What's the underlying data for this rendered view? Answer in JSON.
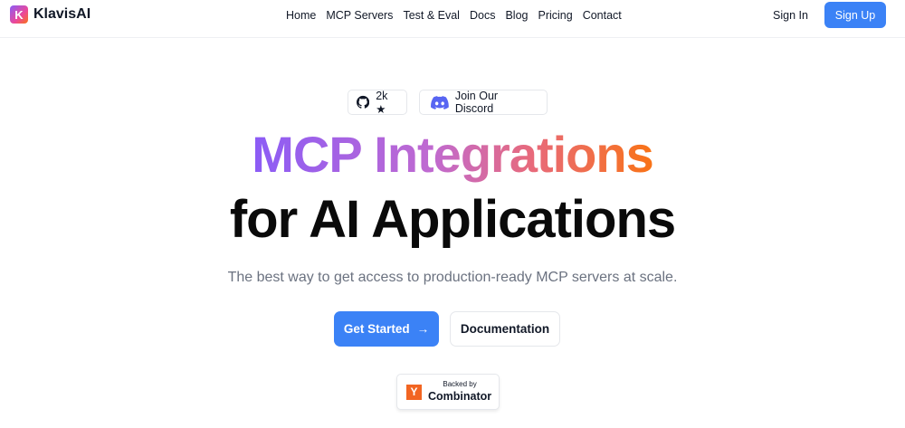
{
  "brand": {
    "logo_letter": "K",
    "name": "KlavisAI"
  },
  "nav": {
    "links": [
      "Home",
      "MCP Servers",
      "Test & Eval",
      "Docs",
      "Blog",
      "Pricing",
      "Contact"
    ],
    "sign_in": "Sign In",
    "sign_up": "Sign Up"
  },
  "badges": {
    "github": {
      "icon": "github-icon",
      "label": "2k ★"
    },
    "discord": {
      "icon": "discord-icon",
      "label": "Join Our Discord"
    }
  },
  "hero": {
    "line1": "MCP Integrations",
    "line2": "for AI Applications",
    "subtitle": "The best way to get access to production-ready MCP servers at scale."
  },
  "cta": {
    "primary": "Get Started",
    "primary_icon": "→",
    "secondary": "Documentation"
  },
  "yc": {
    "letter": "Y",
    "small": "Backed by",
    "big": "Combinator"
  },
  "colors": {
    "accent": "#3b82f6",
    "yc_orange": "#f26522",
    "discord": "#5865f2"
  }
}
